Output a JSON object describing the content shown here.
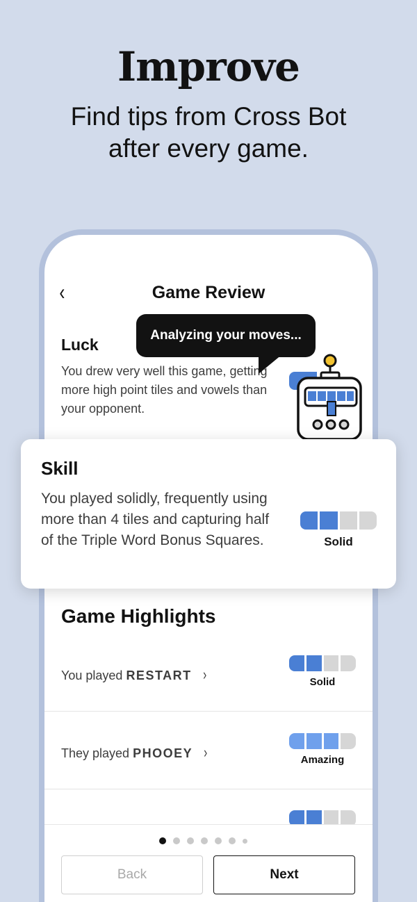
{
  "hero": {
    "title": "Improve",
    "subtitle": "Find tips from Cross Bot after every game."
  },
  "screen": {
    "title": "Game Review",
    "back_glyph": "‹"
  },
  "bubble": {
    "text": "Analyzing your moves..."
  },
  "luck": {
    "title": "Luck",
    "description": "You drew very well this game, getting more high point tiles and vowels than your opponent."
  },
  "skill": {
    "title": "Skill",
    "description": "You played solidly, frequently using more than 4 tiles and capturing half of the Triple Word Bonus Squares.",
    "rating_label": "Solid",
    "rating_level": 2,
    "rating_max": 4
  },
  "highlights": {
    "title": "Game Highlights",
    "items": [
      {
        "prefix": "You played",
        "word": "RESTART",
        "rating_label": "Solid",
        "rating_level": 2,
        "rating_max": 4
      },
      {
        "prefix": "They played",
        "word": "PHOOEY",
        "rating_label": "Amazing",
        "rating_level": 3,
        "rating_max": 4
      }
    ]
  },
  "pagination": {
    "current": 1,
    "total": 7
  },
  "buttons": {
    "back": "Back",
    "next": "Next"
  },
  "colors": {
    "background": "#d2dbeb",
    "phone_border": "#b3c1dc",
    "meter_on": "#4a7fd4",
    "meter_light": "#6fa0ec",
    "meter_off": "#d6d6d6",
    "bubble": "#121212"
  },
  "icons": [
    "chevron-left-icon",
    "chevron-right-icon",
    "robot-mascot-icon"
  ]
}
